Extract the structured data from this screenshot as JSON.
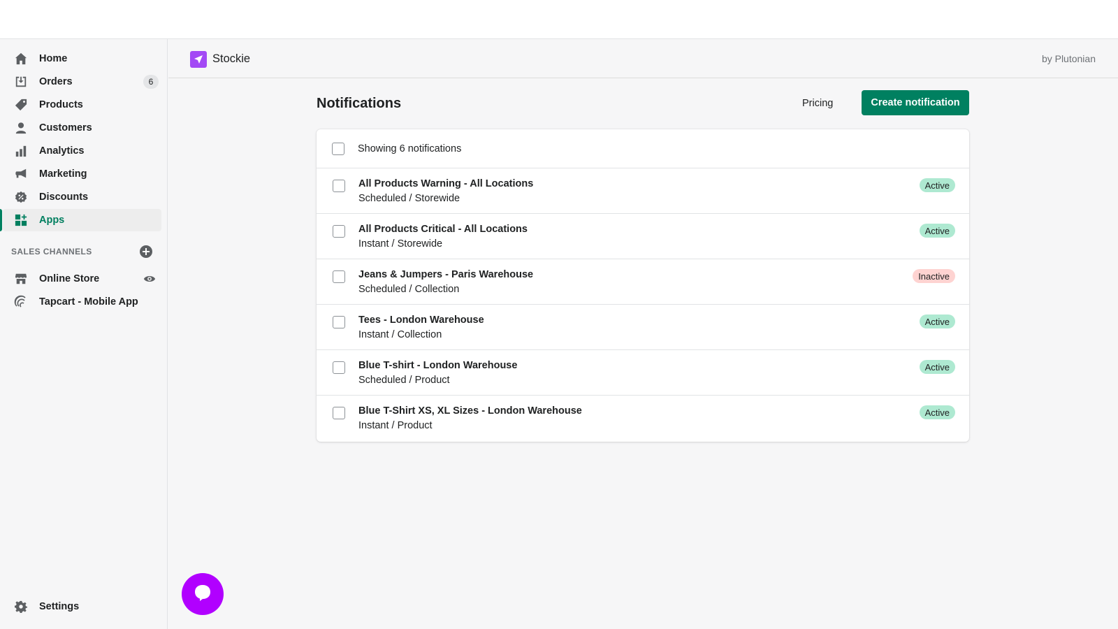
{
  "sidebar": {
    "items": [
      {
        "label": "Home",
        "icon": "home-icon"
      },
      {
        "label": "Orders",
        "icon": "orders-icon",
        "count": "6"
      },
      {
        "label": "Products",
        "icon": "tag-icon"
      },
      {
        "label": "Customers",
        "icon": "person-icon"
      },
      {
        "label": "Analytics",
        "icon": "bar-chart-icon"
      },
      {
        "label": "Marketing",
        "icon": "megaphone-icon"
      },
      {
        "label": "Discounts",
        "icon": "discount-icon"
      },
      {
        "label": "Apps",
        "icon": "apps-icon",
        "active": true
      }
    ],
    "sales_channels_title": "SALES CHANNELS",
    "channels": [
      {
        "label": "Online Store",
        "icon": "store-icon"
      },
      {
        "label": "Tapcart - Mobile App",
        "icon": "tapcart-icon"
      }
    ],
    "settings_label": "Settings"
  },
  "app_header": {
    "name": "Stockie",
    "by": "by Plutonian"
  },
  "page": {
    "title": "Notifications",
    "pricing_label": "Pricing",
    "create_label": "Create notification",
    "showing_text": "Showing 6 notifications"
  },
  "notifications": [
    {
      "title": "All Products Warning - All Locations",
      "sub": "Scheduled / Storewide",
      "status": "Active"
    },
    {
      "title": "All Products Critical - All Locations",
      "sub": "Instant / Storewide",
      "status": "Active"
    },
    {
      "title": "Jeans & Jumpers - Paris Warehouse",
      "sub": "Scheduled / Collection",
      "status": "Inactive"
    },
    {
      "title": "Tees - London Warehouse",
      "sub": "Instant / Collection",
      "status": "Active"
    },
    {
      "title": "Blue T-shirt - London Warehouse",
      "sub": "Scheduled / Product",
      "status": "Active"
    },
    {
      "title": "Blue T-Shirt XS, XL Sizes - London Warehouse",
      "sub": "Instant / Product",
      "status": "Active"
    }
  ],
  "colors": {
    "accent": "#008060",
    "active_badge": "#aee9d1",
    "inactive_badge": "#fed3d1",
    "app_logo": "#a349f5",
    "chat": "#b100ff"
  }
}
